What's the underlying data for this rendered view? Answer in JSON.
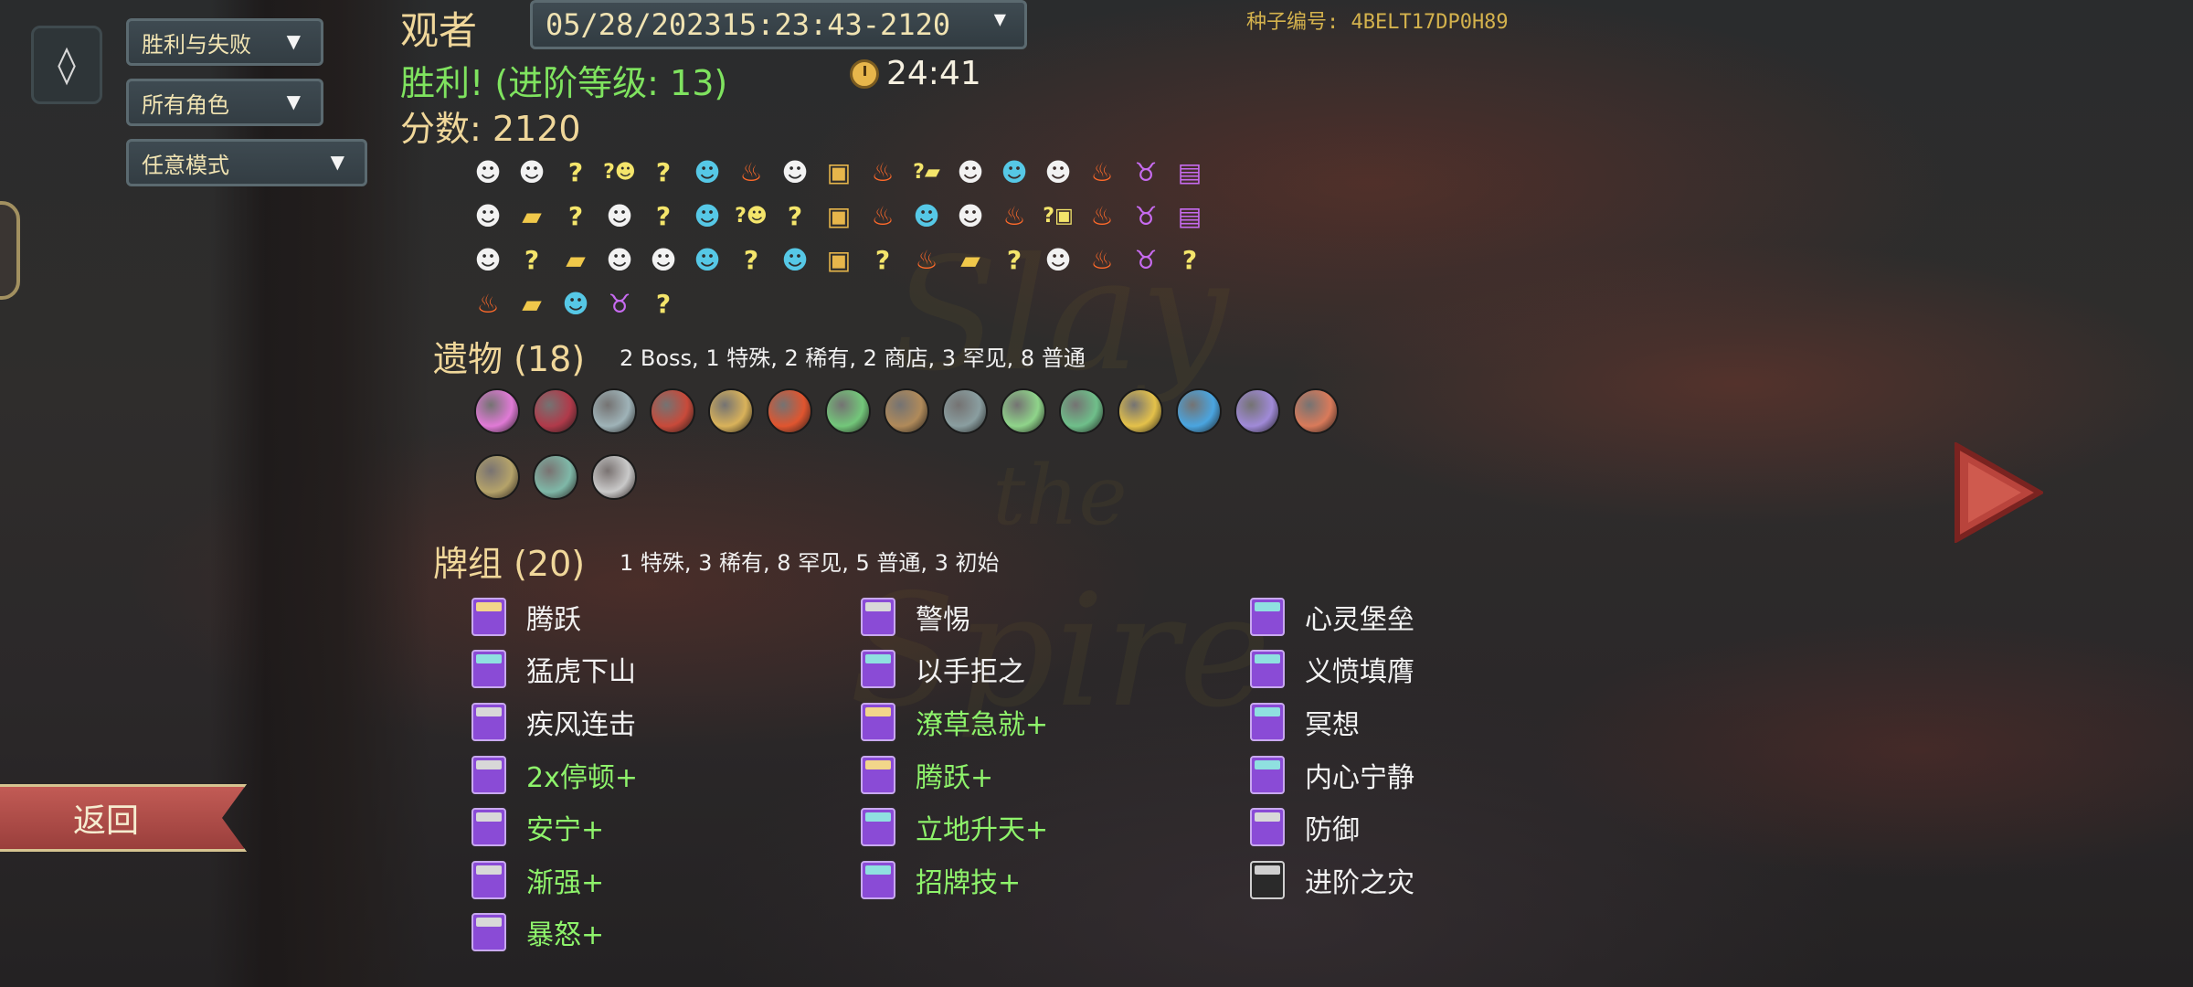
{
  "filters": {
    "result_filter": "胜利与失败",
    "character_filter": "所有角色",
    "mode_filter": "任意模式"
  },
  "header": {
    "character": "观者",
    "run_selector": "05/28/202315:23:43-2120",
    "seed": "种子编号: 4BELT17DP0H89",
    "result": "胜利! (进阶等级: 13)",
    "play_time": "24:41",
    "score": "分数: 2120"
  },
  "buttons": {
    "back": "返回"
  },
  "path": {
    "rows": [
      [
        "monster",
        "monster",
        "unknown",
        "q-monster",
        "unknown",
        "elite",
        "rest",
        "monster",
        "treasure",
        "rest",
        "q-shop",
        "monster",
        "elite",
        "monster",
        "rest",
        "boss",
        "chest-boss"
      ],
      [
        "monster",
        "shop",
        "unknown",
        "monster",
        "unknown",
        "elite",
        "q-monster",
        "unknown",
        "treasure",
        "rest",
        "elite",
        "monster",
        "rest",
        "q-treasure",
        "rest",
        "boss",
        "chest-boss"
      ],
      [
        "monster",
        "unknown",
        "shop",
        "monster",
        "monster",
        "elite",
        "unknown",
        "elite",
        "treasure",
        "unknown",
        "rest",
        "shop",
        "unknown",
        "monster",
        "rest",
        "boss",
        "unknown"
      ],
      [
        "rest",
        "shop",
        "elite",
        "boss",
        "unknown"
      ]
    ]
  },
  "relics": {
    "title": "遗物 (18)",
    "summary": "2  Boss, 1  特殊, 2  稀有, 2  商店, 3  罕见, 8  普通",
    "items": [
      {
        "name": "pure-water-icon",
        "color": "#e07ad6"
      },
      {
        "name": "runic-box-icon",
        "color": "#b03a4a"
      },
      {
        "name": "smooth-stone-icon",
        "color": "#9fb3b8"
      },
      {
        "name": "nunchaku-icon",
        "color": "#c84a3a"
      },
      {
        "name": "paper-crane-icon",
        "color": "#d9b25a"
      },
      {
        "name": "red-stone-icon",
        "color": "#e0552f"
      },
      {
        "name": "bank-note-icon",
        "color": "#73c77a"
      },
      {
        "name": "backpack-icon",
        "color": "#b08a5a"
      },
      {
        "name": "teapot-icon",
        "color": "#8a9ea0"
      },
      {
        "name": "scroll-icon",
        "color": "#8fd48a"
      },
      {
        "name": "shell-icon",
        "color": "#6fbf8a"
      },
      {
        "name": "pen-nib-icon",
        "color": "#e4c14a"
      },
      {
        "name": "feather-icon",
        "color": "#4aa5e0"
      },
      {
        "name": "orb-bag-icon",
        "color": "#a08ad8"
      },
      {
        "name": "meat-icon",
        "color": "#d97a5a"
      },
      {
        "name": "pipe-icon",
        "color": "#b5a36a"
      },
      {
        "name": "totem-icon",
        "color": "#7fb8a8"
      },
      {
        "name": "fish-icon",
        "color": "#c9c9c9"
      }
    ]
  },
  "deck": {
    "title": "牌组 (20)",
    "summary": "1  特殊, 3  稀有, 8  罕见, 5  普通, 3  初始",
    "columns": [
      [
        {
          "name": "腾跃",
          "upgraded": false,
          "top": "#f2d68a"
        },
        {
          "name": "猛虎下山",
          "upgraded": false,
          "top": "#8fe0e0"
        },
        {
          "name": "疾风连击",
          "upgraded": false,
          "top": "#d8d8d8"
        },
        {
          "name": "2x停顿+",
          "upgraded": true,
          "top": "#d8d8d8"
        },
        {
          "name": "安宁+",
          "upgraded": true,
          "top": "#d8d8d8"
        },
        {
          "name": "渐强+",
          "upgraded": true,
          "top": "#d8d8d8"
        },
        {
          "name": "暴怒+",
          "upgraded": true,
          "top": "#d8d8d8"
        }
      ],
      [
        {
          "name": "警惕",
          "upgraded": false,
          "top": "#d8d8d8"
        },
        {
          "name": "以手拒之",
          "upgraded": false,
          "top": "#8fe0e0"
        },
        {
          "name": "潦草急就+",
          "upgraded": true,
          "top": "#f2d68a"
        },
        {
          "name": "腾跃+",
          "upgraded": true,
          "top": "#f2d68a"
        },
        {
          "name": "立地升天+",
          "upgraded": true,
          "top": "#8fe0e0"
        },
        {
          "name": "招牌技+",
          "upgraded": true,
          "top": "#8fe0e0"
        }
      ],
      [
        {
          "name": "心灵堡垒",
          "upgraded": false,
          "top": "#8fe0e0"
        },
        {
          "name": "义愤填膺",
          "upgraded": false,
          "top": "#8fe0e0"
        },
        {
          "name": "冥想",
          "upgraded": false,
          "top": "#8fe0e0"
        },
        {
          "name": "内心宁静",
          "upgraded": false,
          "top": "#8fe0e0"
        },
        {
          "name": "防御",
          "upgraded": false,
          "top": "#d8d8d8"
        },
        {
          "name": "进阶之灾",
          "upgraded": false,
          "top": "#cfcfcf",
          "curse": true
        }
      ]
    ]
  }
}
